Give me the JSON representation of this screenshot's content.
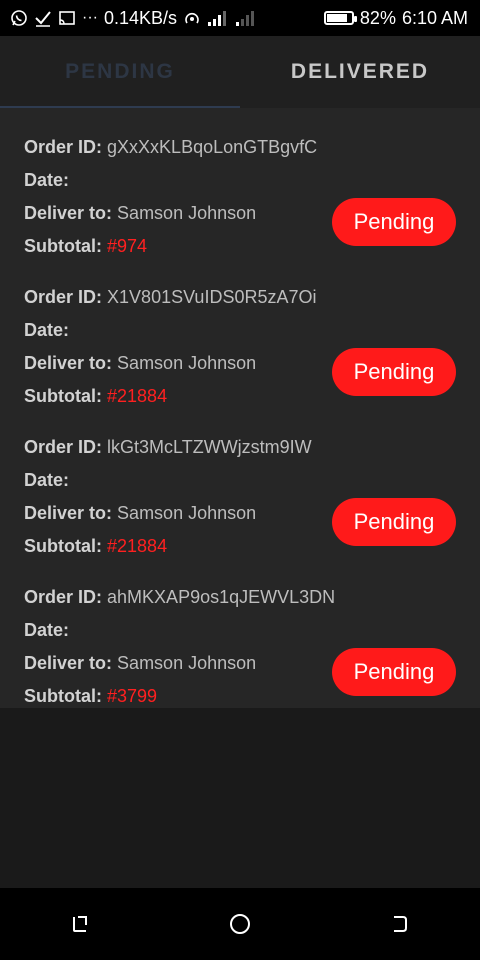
{
  "status_bar": {
    "network_speed": "0.14KB/s",
    "battery": "82%",
    "time": "6:10 AM",
    "battery_level": 0.82
  },
  "tabs": [
    {
      "label": "PENDING"
    },
    {
      "label": "DELIVERED"
    }
  ],
  "labels": {
    "order_id": "Order ID:",
    "date": "Date:",
    "deliver_to": "Deliver to:",
    "subtotal": "Subtotal:"
  },
  "orders": [
    {
      "order_id": "gXxXxKLBqoLonGTBgvfC",
      "date": "",
      "deliver_to": "Samson Johnson",
      "subtotal": "#974",
      "status": "Pending"
    },
    {
      "order_id": "X1V801SVuIDS0R5zA7Oi",
      "date": "",
      "deliver_to": "Samson Johnson",
      "subtotal": "#21884",
      "status": "Pending"
    },
    {
      "order_id": "lkGt3McLTZWWjzstm9IW",
      "date": "",
      "deliver_to": "Samson Johnson",
      "subtotal": "#21884",
      "status": "Pending"
    },
    {
      "order_id": "ahMKXAP9os1qJEWVL3DN",
      "date": "",
      "deliver_to": "Samson Johnson",
      "subtotal": "#3799",
      "status": "Pending"
    }
  ],
  "colors": {
    "accent_red": "#ff1a1a",
    "card_bg": "#262626",
    "page_bg": "#1a1a1a"
  }
}
